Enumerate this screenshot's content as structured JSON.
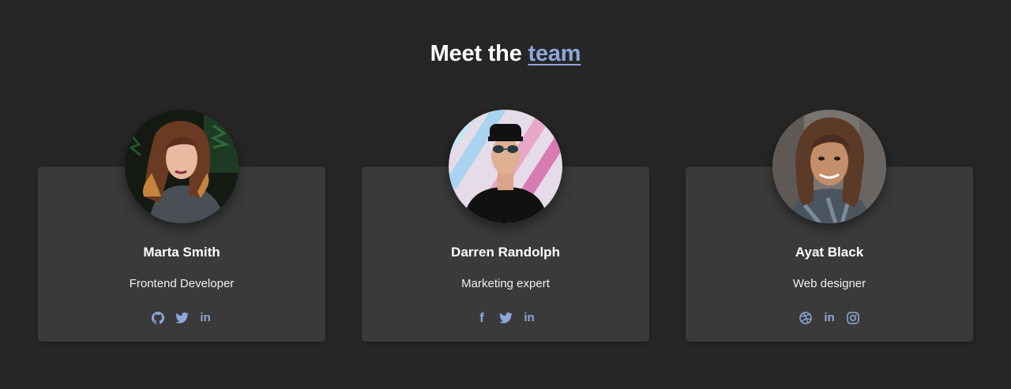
{
  "heading": {
    "prefix": "Meet the",
    "accent": "team"
  },
  "colors": {
    "background": "#262626",
    "card": "#3a3a3a",
    "accent": "#8ea6d8",
    "text": "#ffffff"
  },
  "members": [
    {
      "name": "Marta Smith",
      "role": "Frontend Developer",
      "socials": [
        {
          "icon": "github-icon",
          "glyph": ""
        },
        {
          "icon": "twitter-icon",
          "glyph": ""
        },
        {
          "icon": "linkedin-icon",
          "glyph": "in"
        }
      ]
    },
    {
      "name": "Darren Randolph",
      "role": "Marketing expert",
      "socials": [
        {
          "icon": "facebook-icon",
          "glyph": "f"
        },
        {
          "icon": "twitter-icon",
          "glyph": ""
        },
        {
          "icon": "linkedin-icon",
          "glyph": "in"
        }
      ]
    },
    {
      "name": "Ayat Black",
      "role": "Web designer",
      "socials": [
        {
          "icon": "dribbble-icon",
          "glyph": ""
        },
        {
          "icon": "linkedin-icon",
          "glyph": "in"
        },
        {
          "icon": "instagram-icon",
          "glyph": ""
        }
      ]
    }
  ]
}
